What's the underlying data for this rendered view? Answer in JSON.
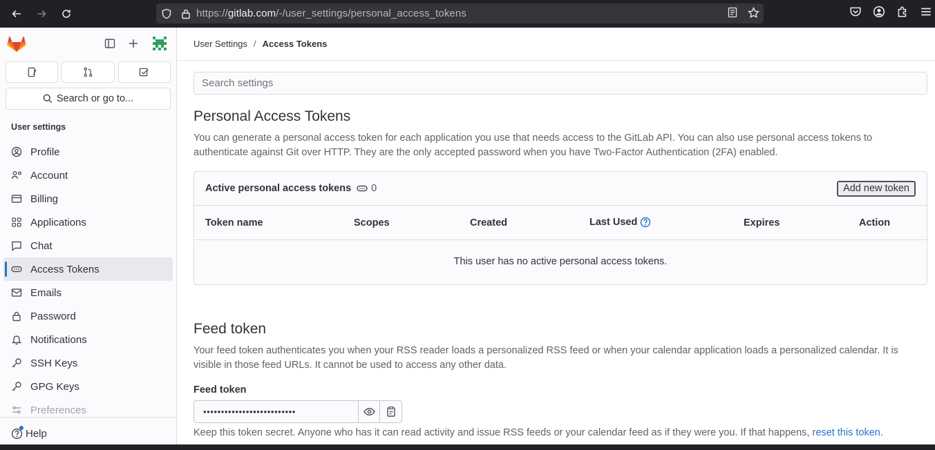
{
  "browser": {
    "url_prefix": "https://",
    "url_host": "gitlab.com",
    "url_path": "/-/user_settings/personal_access_tokens"
  },
  "sidebar": {
    "search_label": "Search or go to...",
    "section_title": "User settings",
    "items": [
      {
        "label": "Profile",
        "icon": "profile-icon"
      },
      {
        "label": "Account",
        "icon": "account-icon"
      },
      {
        "label": "Billing",
        "icon": "billing-icon"
      },
      {
        "label": "Applications",
        "icon": "applications-icon"
      },
      {
        "label": "Chat",
        "icon": "chat-icon"
      },
      {
        "label": "Access Tokens",
        "icon": "token-icon"
      },
      {
        "label": "Emails",
        "icon": "mail-icon"
      },
      {
        "label": "Password",
        "icon": "lock-icon"
      },
      {
        "label": "Notifications",
        "icon": "bell-icon"
      },
      {
        "label": "SSH Keys",
        "icon": "key-icon"
      },
      {
        "label": "GPG Keys",
        "icon": "key-icon"
      },
      {
        "label": "Preferences",
        "icon": "preferences-icon"
      }
    ],
    "help_label": "Help"
  },
  "breadcrumb": {
    "parent": "User Settings",
    "separator": "/",
    "current": "Access Tokens"
  },
  "search": {
    "placeholder": "Search settings"
  },
  "pat": {
    "title": "Personal Access Tokens",
    "description": "You can generate a personal access token for each application you use that needs access to the GitLab API. You can also use personal access tokens to authenticate against Git over HTTP. They are the only accepted password when you have Two-Factor Authentication (2FA) enabled.",
    "card_title": "Active personal access tokens",
    "count": "0",
    "add_button": "Add new token",
    "columns": [
      "Token name",
      "Scopes",
      "Created",
      "Last Used",
      "Expires",
      "Action"
    ],
    "empty_message": "This user has no active personal access tokens."
  },
  "feed": {
    "title": "Feed token",
    "description": "Your feed token authenticates you when your RSS reader loads a personalized RSS feed or when your calendar application loads a personalized calendar. It is visible in those feed URLs. It cannot be used to access any other data.",
    "label": "Feed token",
    "masked_value": "••••••••••••••••••••••••••",
    "help_text": "Keep this token secret. Anyone who has it can read activity and issue RSS feeds or your calendar feed as if they were you. If that happens, ",
    "reset_link": "reset this token."
  },
  "colors": {
    "accent": "#1f75cb",
    "gitlab_orange": "#fc6d26",
    "avatar_green": "#2da160"
  }
}
